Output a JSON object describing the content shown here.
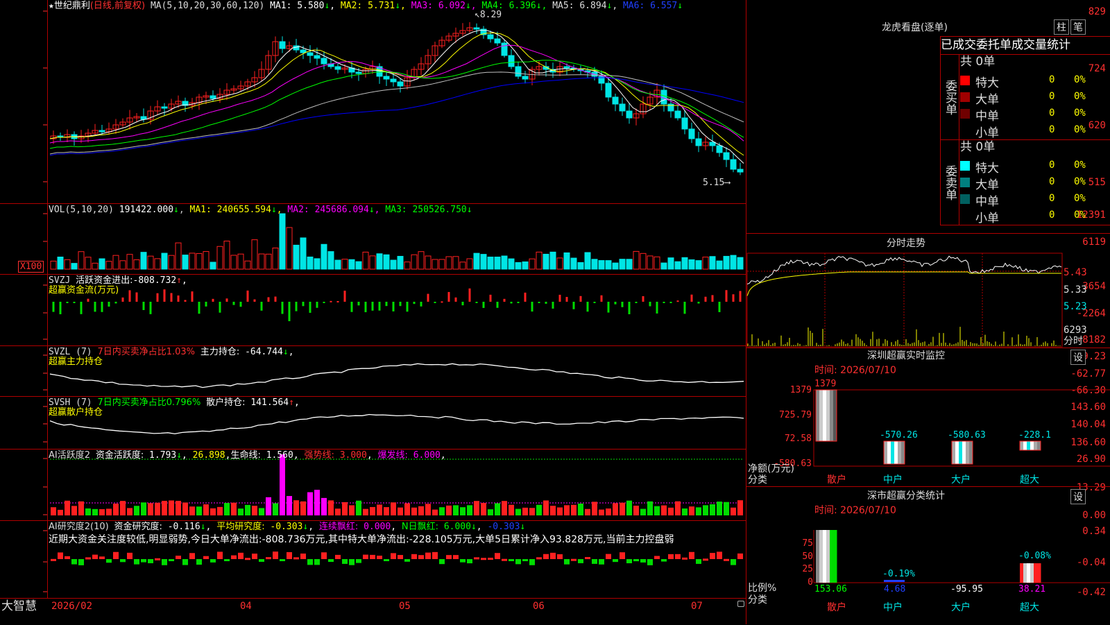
{
  "colors": {
    "up": "#ff2020",
    "down": "#00e5e5",
    "frame": "#b00000",
    "ma1": "#ffffff",
    "ma2": "#ffff00",
    "ma3": "#ff00ff",
    "ma4": "#00ff00",
    "ma5": "#c0c0c0",
    "ma6": "#0000ff",
    "green": "#00dd00",
    "magenta": "#ff00ff",
    "yellow": "#ffff00"
  },
  "app": {
    "name": "大智慧"
  },
  "price_panel": {
    "star": "★",
    "stock": "世纪鼎利",
    "mode": "(日线,前复权)",
    "ma_title": "MA(5,10,20,30,60,120)",
    "ma": [
      {
        "label": "MA1:",
        "value": "5.580",
        "arrow": "↓"
      },
      {
        "label": "MA2:",
        "value": "5.731",
        "arrow": "↓"
      },
      {
        "label": "MA3:",
        "value": "6.092",
        "arrow": "↓"
      },
      {
        "label": "MA4:",
        "value": "6.396",
        "arrow": "↓"
      },
      {
        "label": "MA5:",
        "value": "6.894",
        "arrow": "↓"
      },
      {
        "label": "MA6:",
        "value": "6.557",
        "arrow": "↓"
      }
    ],
    "yticks": [
      "829",
      "724",
      "620",
      "515"
    ],
    "high_mark": "8.29",
    "low_mark": "5.15"
  },
  "vol_panel": {
    "title": "VOL(5,10,20)",
    "value": "191422.000",
    "arrow": "↓",
    "ma": [
      {
        "label": "MA1:",
        "value": "240655.594",
        "arrow": "↓"
      },
      {
        "label": "MA2:",
        "value": "245686.094",
        "arrow": "↓"
      },
      {
        "label": "MA3:",
        "value": "250526.750",
        "arrow": "↓"
      }
    ],
    "yticks": [
      "12391",
      "6119"
    ],
    "unit": "X100"
  },
  "svzj_panel": {
    "title": "SVZJ",
    "label": "活跃资金进出:",
    "value": "-808.732",
    "arrow": "↑",
    "sep": ",",
    "sub": "超赢资金流(万元)",
    "yticks": [
      "3654",
      "-2264",
      "-8182"
    ]
  },
  "svzl_panel": {
    "title": "SVZL (7)",
    "ratio": "7日内买卖净占比1.03%",
    "label": "主力持仓:",
    "value": "-64.744",
    "arrow": "↓",
    "sep": ",",
    "sub": "超赢主力持仓",
    "yticks": [
      "-59.23",
      "-62.77",
      "-66.30"
    ]
  },
  "svsh_panel": {
    "title": "SVSH (7)",
    "ratio": "7日内买卖净占比0.796%",
    "label": "散户持仓:",
    "value": "141.564",
    "arrow": "↑",
    "sep": ",",
    "sub": "超赢散户持仓",
    "yticks": [
      "143.60",
      "140.04",
      "136.60"
    ]
  },
  "ai1_panel": {
    "title": "AI活跃度2",
    "label": "资金活跃度:",
    "value": "1.793",
    "arrow": "↓",
    "v2": "26.898",
    "label3": "生命线:",
    "v3": "1.560",
    "label4": "强势线:",
    "v4": "3.000",
    "label5": "爆发线:",
    "v5": "6.000",
    "sep": ",",
    "yticks": [
      "26.90",
      "13.29",
      "0.00"
    ]
  },
  "ai2_panel": {
    "title": "AI研究度2(10)",
    "label": "资金研究度:",
    "value": "-0.116",
    "arrow": "↓",
    "label2": "平均研究度:",
    "v2": "-0.303",
    "label3": "连续飘红:",
    "v3": "0.000",
    "label4": "N日飘红:",
    "v4": "6.000",
    "v5": "-0.303",
    "arrow_up": "↑",
    "sep": ",",
    "text": "近期大资金关注度较低,明显弱势,今日大单净流出:-808.736万元,其中特大单净流出:-228.105万元,大单5日累计净入93.828万元,当前主力控盘弱",
    "yticks": [
      "0.34",
      "-0.04",
      "-0.42"
    ]
  },
  "xaxis": {
    "labels": [
      "2026/02",
      "04",
      "05",
      "06",
      "07"
    ]
  },
  "lhb": {
    "title": "龙虎看盘(逐单)",
    "btn1": "柱",
    "btn2": "笔",
    "tabs": [
      "已成交",
      "委托单",
      "成交量",
      "统计"
    ],
    "buy": {
      "vlabel": "委买单",
      "total": "共 0单",
      "rows": [
        {
          "name": "特大",
          "v": "0",
          "p": "0%",
          "color": "#ff0000"
        },
        {
          "name": "大单",
          "v": "0",
          "p": "0%",
          "color": "#a00000"
        },
        {
          "name": "中单",
          "v": "0",
          "p": "0%",
          "color": "#700000"
        },
        {
          "name": "小单",
          "v": "0",
          "p": "0%",
          "color": "#000000"
        }
      ]
    },
    "sell": {
      "vlabel": "委卖单",
      "total": "共 0单",
      "rows": [
        {
          "name": "特大",
          "v": "0",
          "p": "0%",
          "color": "#00ffff"
        },
        {
          "name": "大单",
          "v": "0",
          "p": "0%",
          "color": "#008080"
        },
        {
          "name": "中单",
          "v": "0",
          "p": "0%",
          "color": "#006060"
        },
        {
          "name": "小单",
          "v": "0",
          "p": "0%",
          "color": "#000000"
        }
      ]
    }
  },
  "intraday": {
    "title": "分时走势",
    "yticks": [
      "5.43",
      "5.33",
      "5.23"
    ],
    "vol": "6293",
    "vol_unit": "分时"
  },
  "szmon": {
    "title": "深圳超赢实时监控",
    "btn": "设",
    "time": "时间: 2026/07/10",
    "yticks": [
      "1379",
      "725.79",
      "72.58",
      "-580.63"
    ],
    "top": "1379",
    "y_label": "净额(万元)",
    "x_label": "分类",
    "cats": [
      "散户",
      "中户",
      "大户",
      "超大"
    ],
    "labels": [
      "1379",
      "-570.26",
      "-580.63",
      "-228.1"
    ]
  },
  "szcls": {
    "title": "深市超赢分类统计",
    "btn": "设",
    "time": "时间: 2026/07/10",
    "yticks": [
      "75",
      "50",
      "25",
      "0"
    ],
    "y_label": "比例%",
    "x_label": "分类",
    "cats": [
      "散户",
      "中户",
      "大户",
      "超大"
    ],
    "top_labels": [
      "",
      "-0.19%",
      "",
      "-0.08%"
    ],
    "bottom_labels": [
      "153.06",
      "4.68",
      "-95.95",
      "38.21"
    ]
  }
}
